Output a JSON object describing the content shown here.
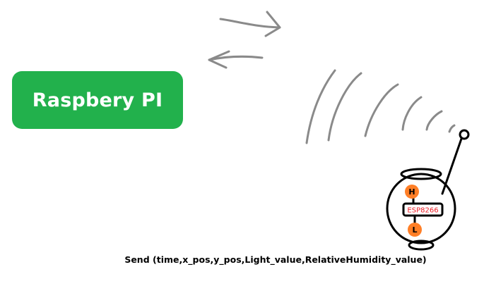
{
  "raspberry_pi": {
    "label": "Raspbery PI",
    "color": "#22b14c"
  },
  "esp_device": {
    "chip_label": "ESP8266",
    "high_pin": "H",
    "low_pin": "L",
    "pin_color": "#ff7f27",
    "chip_text_color": "#ed1c24"
  },
  "caption": "Send (time,x_pos,y_pos,Light_value,RelativeHumidity_value)",
  "icons": [
    "arrow-right-icon",
    "arrow-left-icon",
    "wifi-waves-icon",
    "antenna-icon"
  ]
}
